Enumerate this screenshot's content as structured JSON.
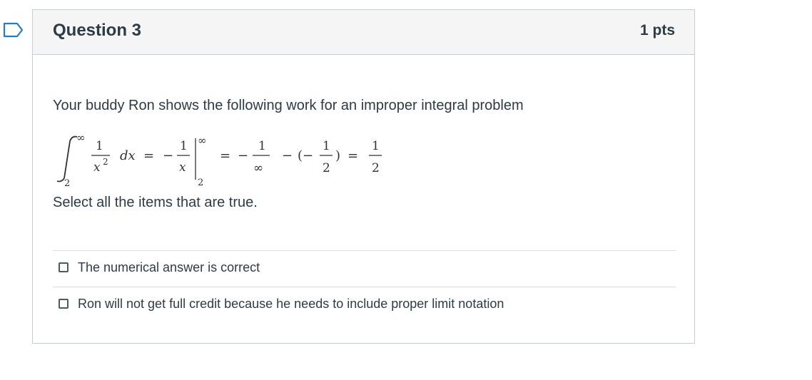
{
  "question": {
    "title": "Question 3",
    "points": "1 pts",
    "prompt": "Your buddy Ron shows the following work for an improper integral problem",
    "instruction": "Select all the items that are true."
  },
  "math": {
    "upper_limit": "∞",
    "lower_limit": "2",
    "integrand_num": "1",
    "integrand_den": "x",
    "integrand_den_exp": "2",
    "differential": "dx",
    "equals": "=",
    "minus": "−",
    "antideriv_num": "1",
    "antideriv_den": "x",
    "eval_upper": "∞",
    "eval_lower": "2",
    "term1_num": "1",
    "term1_den": "∞",
    "paren_open": "(−",
    "term2_num": "1",
    "term2_den": "2",
    "paren_close": ")",
    "result_num": "1",
    "result_den": "2"
  },
  "answers": [
    {
      "label": "The numerical answer is correct",
      "checked": false
    },
    {
      "label": "Ron will not get full credit because he needs to include proper limit notation",
      "checked": false
    }
  ],
  "colors": {
    "flag_stroke": "#2b7abc",
    "header_bg": "#f5f5f5",
    "border": "#c7cdd1",
    "text": "#2d3b45"
  }
}
